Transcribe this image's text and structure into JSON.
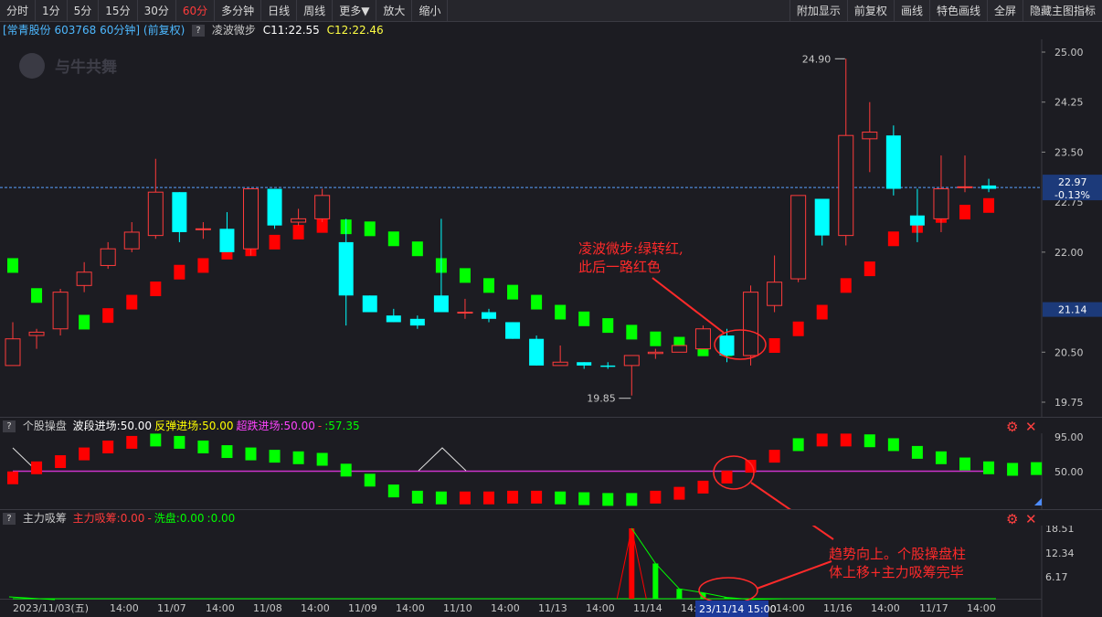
{
  "toolbar": {
    "left": [
      "分时",
      "1分",
      "5分",
      "15分",
      "30分",
      "60分",
      "多分钟",
      "日线",
      "周线",
      "更多▼",
      "放大",
      "缩小"
    ],
    "active": "60分",
    "right": [
      "附加显示",
      "前复权",
      "画线",
      "特色画线",
      "全屏",
      "隐藏主图指标"
    ]
  },
  "info": {
    "stock": "[常青股份 603768 60分钟] (前复权)",
    "indicator": "凌波微步",
    "c1": "C11:22.55",
    "c2": "C12:22.46"
  },
  "watermark": "与牛共舞",
  "colors": {
    "up": "#ff3b3b",
    "down": "#00ffff",
    "green": "#00ff00",
    "red": "#ff0000",
    "magenta": "#cc33cc",
    "annotation": "#ff2a2a",
    "price_line": "#5aa0ff"
  },
  "main_axis": {
    "ticks": [
      "25.00",
      "24.25",
      "23.50",
      "22.00",
      "20.50",
      "19.75"
    ],
    "tick_values": [
      25.0,
      24.25,
      23.5,
      22.0,
      20.5,
      19.75
    ],
    "overlapped_tick": "22.75",
    "current_price": "22.97",
    "current_change": "-0.13%",
    "line_price": "21.14"
  },
  "max_label": "24.90",
  "min_label": "19.85",
  "panel2": {
    "title": "个股操盘",
    "items": [
      {
        "text": "波段进场:50.00",
        "color": "#ffffff"
      },
      {
        "text": "反弹进场:50.00",
        "color": "#ffff00"
      },
      {
        "text": "超跌进场:50.00",
        "color": "#ff44ff"
      },
      {
        "text": "-",
        "color": "#ff3b3b"
      },
      {
        "text": ":57.35",
        "color": "#00ff00"
      }
    ],
    "ticks": [
      "95.00",
      "50.00"
    ]
  },
  "panel3": {
    "title": "主力吸筹",
    "items": [
      {
        "text": "主力吸筹:0.00",
        "color": "#ff3b3b"
      },
      {
        "text": "-",
        "color": "#ff3b3b"
      },
      {
        "text": "洗盘:0.00",
        "color": "#00ff00"
      },
      {
        "text": ":0.00",
        "color": "#00ff00"
      }
    ],
    "ticks": [
      "18.51",
      "12.34",
      "6.17"
    ]
  },
  "dates": [
    "2023/11/03(五)",
    "14:00",
    "11/07",
    "14:00",
    "11/08",
    "14:00",
    "11/09",
    "14:00",
    "11/10",
    "14:00",
    "11/13",
    "14:00",
    "11/14",
    "14:00",
    "11/15",
    "14:00",
    "11/16",
    "14:00",
    "11/17",
    "14:00"
  ],
  "cursor_date": "23/11/14 15:00",
  "annotations": {
    "a1_line1": "凌波微步:绿转红,",
    "a1_line2": "此后一路红色",
    "a2_line1": "趋势向上。个股操盘柱",
    "a2_line2": "体上移+主力吸筹完毕"
  },
  "chart_data": {
    "type": "candlestick",
    "candles": [
      {
        "o": 20.3,
        "h": 20.95,
        "l": 20.3,
        "c": 20.7
      },
      {
        "o": 20.75,
        "h": 20.85,
        "l": 20.55,
        "c": 20.8
      },
      {
        "o": 20.85,
        "h": 21.45,
        "l": 20.75,
        "c": 21.4
      },
      {
        "o": 21.5,
        "h": 21.85,
        "l": 21.4,
        "c": 21.7
      },
      {
        "o": 21.8,
        "h": 22.15,
        "l": 21.75,
        "c": 22.05
      },
      {
        "o": 22.05,
        "h": 22.45,
        "l": 22.0,
        "c": 22.3
      },
      {
        "o": 22.25,
        "h": 23.4,
        "l": 22.2,
        "c": 22.9
      },
      {
        "o": 22.9,
        "h": 22.9,
        "l": 22.15,
        "c": 22.3
      },
      {
        "o": 22.35,
        "h": 22.45,
        "l": 22.2,
        "c": 22.35
      },
      {
        "o": 22.35,
        "h": 22.6,
        "l": 22.0,
        "c": 22.0
      },
      {
        "o": 22.05,
        "h": 22.95,
        "l": 21.95,
        "c": 22.95
      },
      {
        "o": 22.95,
        "h": 22.95,
        "l": 22.35,
        "c": 22.4
      },
      {
        "o": 22.45,
        "h": 22.65,
        "l": 22.4,
        "c": 22.5
      },
      {
        "o": 22.5,
        "h": 22.95,
        "l": 22.45,
        "c": 22.85
      },
      {
        "o": 22.15,
        "h": 22.5,
        "l": 20.9,
        "c": 21.35
      },
      {
        "o": 21.35,
        "h": 21.35,
        "l": 21.1,
        "c": 21.1
      },
      {
        "o": 21.05,
        "h": 21.15,
        "l": 20.95,
        "c": 20.95
      },
      {
        "o": 21.0,
        "h": 21.05,
        "l": 20.85,
        "c": 20.9
      },
      {
        "o": 21.35,
        "h": 22.5,
        "l": 21.1,
        "c": 21.1
      },
      {
        "o": 21.1,
        "h": 21.3,
        "l": 21.0,
        "c": 21.1
      },
      {
        "o": 21.1,
        "h": 21.15,
        "l": 20.95,
        "c": 21.0
      },
      {
        "o": 20.95,
        "h": 20.95,
        "l": 20.7,
        "c": 20.7
      },
      {
        "o": 20.7,
        "h": 20.75,
        "l": 20.3,
        "c": 20.3
      },
      {
        "o": 20.3,
        "h": 20.6,
        "l": 20.3,
        "c": 20.35
      },
      {
        "o": 20.35,
        "h": 20.35,
        "l": 20.25,
        "c": 20.3
      },
      {
        "o": 20.3,
        "h": 20.35,
        "l": 20.25,
        "c": 20.28
      },
      {
        "o": 20.3,
        "h": 20.45,
        "l": 19.85,
        "c": 20.45
      },
      {
        "o": 20.48,
        "h": 20.55,
        "l": 20.4,
        "c": 20.5
      },
      {
        "o": 20.5,
        "h": 20.6,
        "l": 20.5,
        "c": 20.6
      },
      {
        "o": 20.55,
        "h": 20.9,
        "l": 20.55,
        "c": 20.85
      },
      {
        "o": 20.75,
        "h": 20.85,
        "l": 20.35,
        "c": 20.45
      },
      {
        "o": 20.45,
        "h": 21.5,
        "l": 20.3,
        "c": 21.4
      },
      {
        "o": 21.2,
        "h": 21.95,
        "l": 21.1,
        "c": 21.55
      },
      {
        "o": 21.6,
        "h": 22.85,
        "l": 21.55,
        "c": 22.85
      },
      {
        "o": 22.8,
        "h": 22.8,
        "l": 22.1,
        "c": 22.25
      },
      {
        "o": 22.25,
        "h": 24.9,
        "l": 22.1,
        "c": 23.75
      },
      {
        "o": 23.7,
        "h": 24.25,
        "l": 23.2,
        "c": 23.8
      },
      {
        "o": 23.75,
        "h": 23.9,
        "l": 22.85,
        "c": 22.95
      },
      {
        "o": 22.55,
        "h": 22.95,
        "l": 22.15,
        "c": 22.4
      },
      {
        "o": 22.5,
        "h": 23.45,
        "l": 22.3,
        "c": 22.95
      },
      {
        "o": 22.98,
        "h": 23.45,
        "l": 22.9,
        "c": 22.98
      },
      {
        "o": 23.0,
        "h": 23.1,
        "l": 22.9,
        "c": 22.95
      }
    ],
    "lbwb": [
      {
        "v": 21.8,
        "c": "g"
      },
      {
        "v": 21.35,
        "c": "g"
      },
      {
        "v": 21.1,
        "c": "g"
      },
      {
        "v": 20.95,
        "c": "g"
      },
      {
        "v": 21.05,
        "c": "r"
      },
      {
        "v": 21.25,
        "c": "r"
      },
      {
        "v": 21.45,
        "c": "r"
      },
      {
        "v": 21.7,
        "c": "r"
      },
      {
        "v": 21.8,
        "c": "r"
      },
      {
        "v": 22.0,
        "c": "r"
      },
      {
        "v": 22.05,
        "c": "r"
      },
      {
        "v": 22.15,
        "c": "r"
      },
      {
        "v": 22.3,
        "c": "r"
      },
      {
        "v": 22.4,
        "c": "r"
      },
      {
        "v": 22.38,
        "c": "g"
      },
      {
        "v": 22.35,
        "c": "g"
      },
      {
        "v": 22.2,
        "c": "g"
      },
      {
        "v": 22.05,
        "c": "g"
      },
      {
        "v": 21.8,
        "c": "g"
      },
      {
        "v": 21.65,
        "c": "g"
      },
      {
        "v": 21.5,
        "c": "g"
      },
      {
        "v": 21.4,
        "c": "g"
      },
      {
        "v": 21.25,
        "c": "g"
      },
      {
        "v": 21.1,
        "c": "g"
      },
      {
        "v": 21.0,
        "c": "g"
      },
      {
        "v": 20.9,
        "c": "g"
      },
      {
        "v": 20.8,
        "c": "g"
      },
      {
        "v": 20.7,
        "c": "g"
      },
      {
        "v": 20.62,
        "c": "g"
      },
      {
        "v": 20.55,
        "c": "g"
      },
      {
        "v": 20.55,
        "c": "g"
      },
      {
        "v": 20.55,
        "c": "r"
      },
      {
        "v": 20.6,
        "c": "r"
      },
      {
        "v": 20.85,
        "c": "r"
      },
      {
        "v": 21.1,
        "c": "r"
      },
      {
        "v": 21.5,
        "c": "r"
      },
      {
        "v": 21.75,
        "c": "r"
      },
      {
        "v": 22.2,
        "c": "r"
      },
      {
        "v": 22.4,
        "c": "r"
      },
      {
        "v": 22.55,
        "c": "r"
      },
      {
        "v": 22.6,
        "c": "r"
      },
      {
        "v": 22.7,
        "c": "r"
      }
    ],
    "ops": [
      {
        "v": 42,
        "c": "r"
      },
      {
        "v": 55,
        "c": "r"
      },
      {
        "v": 63,
        "c": "r"
      },
      {
        "v": 73,
        "c": "r"
      },
      {
        "v": 82,
        "c": "r"
      },
      {
        "v": 88,
        "c": "r"
      },
      {
        "v": 91,
        "c": "g"
      },
      {
        "v": 88,
        "c": "g"
      },
      {
        "v": 82,
        "c": "g"
      },
      {
        "v": 76,
        "c": "g"
      },
      {
        "v": 73,
        "c": "g"
      },
      {
        "v": 70,
        "c": "g"
      },
      {
        "v": 68,
        "c": "g"
      },
      {
        "v": 66,
        "c": "g"
      },
      {
        "v": 52,
        "c": "g"
      },
      {
        "v": 39,
        "c": "g"
      },
      {
        "v": 25,
        "c": "g"
      },
      {
        "v": 17,
        "c": "g"
      },
      {
        "v": 16,
        "c": "g"
      },
      {
        "v": 16,
        "c": "r"
      },
      {
        "v": 16,
        "c": "r"
      },
      {
        "v": 17,
        "c": "r"
      },
      {
        "v": 17,
        "c": "r"
      },
      {
        "v": 16,
        "c": "g"
      },
      {
        "v": 15,
        "c": "g"
      },
      {
        "v": 14,
        "c": "g"
      },
      {
        "v": 14,
        "c": "g"
      },
      {
        "v": 17,
        "c": "r"
      },
      {
        "v": 22,
        "c": "r"
      },
      {
        "v": 30,
        "c": "r"
      },
      {
        "v": 43,
        "c": "r"
      },
      {
        "v": 57,
        "c": "r"
      },
      {
        "v": 70,
        "c": "r"
      },
      {
        "v": 85,
        "c": "g"
      },
      {
        "v": 91,
        "c": "r"
      },
      {
        "v": 91,
        "c": "r"
      },
      {
        "v": 90,
        "c": "g"
      },
      {
        "v": 85,
        "c": "g"
      },
      {
        "v": 75,
        "c": "g"
      },
      {
        "v": 68,
        "c": "g"
      },
      {
        "v": 60,
        "c": "g"
      },
      {
        "v": 55,
        "c": "g"
      },
      {
        "v": 53,
        "c": "g"
      },
      {
        "v": 54,
        "c": "g"
      }
    ],
    "ops_white_line": [
      {
        "i": 0,
        "v": 80
      },
      {
        "i": 1,
        "v": 50
      },
      {
        "i": 17,
        "v": 50
      },
      {
        "i": 18,
        "v": 80
      },
      {
        "i": 19,
        "v": 50
      }
    ],
    "xc_red": [
      {
        "i": 26,
        "v": 18.51
      }
    ],
    "xc_green": [
      {
        "i": 27,
        "v": 9.5
      },
      {
        "i": 28,
        "v": 3.0
      },
      {
        "i": 29,
        "v": 2.0
      },
      {
        "i": 30,
        "v": 0.8
      },
      {
        "i": 31,
        "v": 0.3
      }
    ]
  }
}
